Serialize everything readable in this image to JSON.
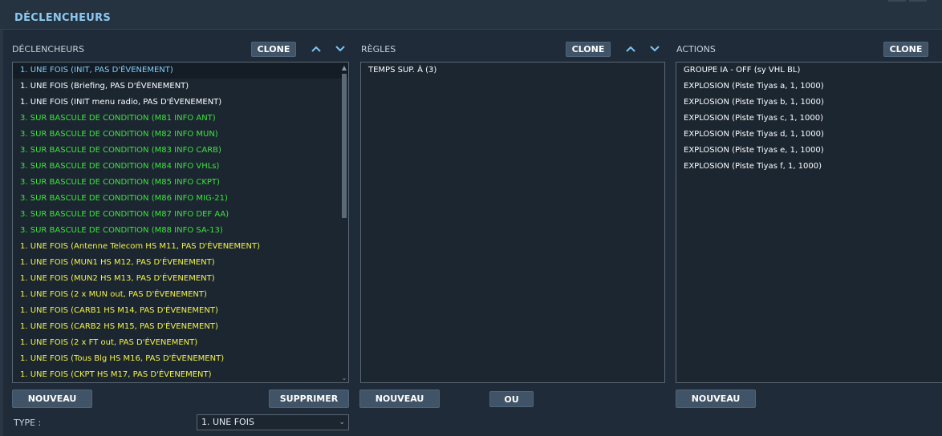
{
  "header": {
    "title": "DÉCLENCHEURS"
  },
  "triggers": {
    "label": "DÉCLENCHEURS",
    "clone_label": "CLONE",
    "new_label": "NOUVEAU",
    "delete_label": "SUPPRIMER",
    "items": [
      {
        "text": "1. UNE FOIS (INIT, PAS D'ÉVENEMENT)",
        "color": "#7fd0ff",
        "selected": true
      },
      {
        "text": "1. UNE FOIS (Briefing, PAS D'ÉVENEMENT)",
        "color": "#ffffff"
      },
      {
        "text": "1. UNE FOIS (INIT menu radio, PAS D'ÉVENEMENT)",
        "color": "#ffffff"
      },
      {
        "text": "3. SUR BASCULE DE CONDITION (M81 INFO ANT)",
        "color": "#3ee23e"
      },
      {
        "text": "3. SUR BASCULE DE CONDITION (M82 INFO MUN)",
        "color": "#3ee23e"
      },
      {
        "text": "3. SUR BASCULE DE CONDITION (M83 INFO CARB)",
        "color": "#3ee23e"
      },
      {
        "text": "3. SUR BASCULE DE CONDITION (M84 INFO VHLs)",
        "color": "#3ee23e"
      },
      {
        "text": "3. SUR BASCULE DE CONDITION (M85 INFO CKPT)",
        "color": "#3ee23e"
      },
      {
        "text": "3. SUR BASCULE DE CONDITION (M86 INFO MIG-21)",
        "color": "#3ee23e"
      },
      {
        "text": "3. SUR BASCULE DE CONDITION (M87 INFO DEF AA)",
        "color": "#3ee23e"
      },
      {
        "text": "3. SUR BASCULE DE CONDITION (M88 INFO SA-13)",
        "color": "#3ee23e"
      },
      {
        "text": "1. UNE FOIS (Antenne Telecom HS M11, PAS D'ÉVENEMENT)",
        "color": "#f2f24a"
      },
      {
        "text": "1. UNE FOIS (MUN1 HS M12, PAS D'ÉVENEMENT)",
        "color": "#f2f24a"
      },
      {
        "text": "1. UNE FOIS (MUN2 HS M13, PAS D'ÉVENEMENT)",
        "color": "#f2f24a"
      },
      {
        "text": "1. UNE FOIS (2 x MUN out, PAS D'ÉVENEMENT)",
        "color": "#f2f24a"
      },
      {
        "text": "1. UNE FOIS (CARB1 HS M14, PAS D'ÉVENEMENT)",
        "color": "#f2f24a"
      },
      {
        "text": "1. UNE FOIS (CARB2 HS M15, PAS D'ÉVENEMENT)",
        "color": "#f2f24a"
      },
      {
        "text": "1. UNE FOIS (2 x FT out, PAS D'ÉVENEMENT)",
        "color": "#f2f24a"
      },
      {
        "text": "1. UNE FOIS (Tous Blg HS M16, PAS D'ÉVENEMENT)",
        "color": "#f2f24a"
      },
      {
        "text": "1. UNE FOIS (CKPT HS M17, PAS D'ÉVENEMENT)",
        "color": "#f2f24a"
      }
    ]
  },
  "rules": {
    "label": "RÈGLES",
    "clone_label": "CLONE",
    "new_label": "NOUVEAU",
    "or_label": "OU",
    "items": [
      {
        "text": "TEMPS SUP. À (3)",
        "color": "#ffffff"
      }
    ]
  },
  "actions": {
    "label": "ACTIONS",
    "clone_label": "CLONE",
    "new_label": "NOUVEAU",
    "items": [
      {
        "text": "GROUPE IA - OFF (sy VHL BL)",
        "color": "#ffffff"
      },
      {
        "text": "EXPLOSION (Piste Tiyas a, 1, 1000)",
        "color": "#ffffff"
      },
      {
        "text": "EXPLOSION (Piste Tiyas b, 1, 1000)",
        "color": "#ffffff"
      },
      {
        "text": "EXPLOSION (Piste Tiyas c, 1, 1000)",
        "color": "#ffffff"
      },
      {
        "text": "EXPLOSION (Piste Tiyas d, 1, 1000)",
        "color": "#ffffff"
      },
      {
        "text": "EXPLOSION (Piste Tiyas e, 1, 1000)",
        "color": "#ffffff"
      },
      {
        "text": "EXPLOSION (Piste Tiyas f, 1, 1000)",
        "color": "#ffffff"
      }
    ]
  },
  "type_field": {
    "label": "TYPE :",
    "value": "1. UNE FOIS"
  },
  "icons": {
    "move_up": "chevron-up-icon",
    "move_down": "chevron-down-icon",
    "dropdown": "chevron-down-icon"
  }
}
